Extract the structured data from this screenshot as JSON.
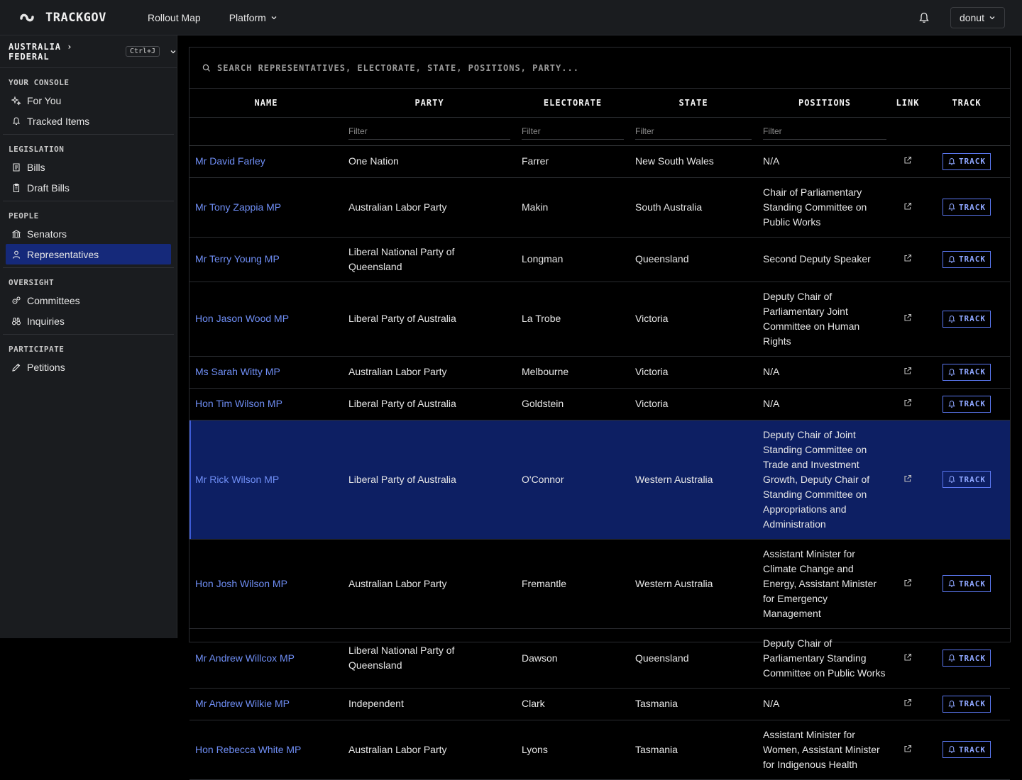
{
  "app": {
    "logo_text": "TRACKGOV",
    "nav": [
      {
        "label": "Rollout Map"
      },
      {
        "label": "Platform"
      }
    ],
    "user": "donut"
  },
  "sidebar": {
    "jurisdiction": "AUSTRALIA › FEDERAL",
    "shortcut": "Ctrl+J",
    "sections": [
      {
        "title": "YOUR CONSOLE",
        "items": [
          {
            "label": "For You",
            "icon": "sparkle-icon"
          },
          {
            "label": "Tracked Items",
            "icon": "bell-icon"
          }
        ]
      },
      {
        "title": "LEGISLATION",
        "items": [
          {
            "label": "Bills",
            "icon": "scroll-icon"
          },
          {
            "label": "Draft Bills",
            "icon": "clipboard-icon"
          }
        ]
      },
      {
        "title": "PEOPLE",
        "items": [
          {
            "label": "Senators",
            "icon": "building-icon"
          },
          {
            "label": "Representatives",
            "icon": "person-icon"
          }
        ]
      },
      {
        "title": "OVERSIGHT",
        "items": [
          {
            "label": "Committees",
            "icon": "cog-group-icon"
          },
          {
            "label": "Inquiries",
            "icon": "binoculars-icon"
          }
        ]
      },
      {
        "title": "PARTICIPATE",
        "items": [
          {
            "label": "Petitions",
            "icon": "pen-icon"
          }
        ]
      }
    ],
    "active_item": "Representatives"
  },
  "search": {
    "placeholder": "SEARCH REPRESENTATIVES, ELECTORATE, STATE, POSITIONS, PARTY..."
  },
  "table": {
    "columns": [
      "NAME",
      "PARTY",
      "ELECTORATE",
      "STATE",
      "POSITIONS",
      "LINK",
      "TRACK"
    ],
    "filter_placeholder": "Filter",
    "track_label": "TRACK",
    "rows": [
      {
        "name": "Mr David Farley",
        "party": "One Nation",
        "electorate": "Farrer",
        "state": "New South Wales",
        "positions": "N/A"
      },
      {
        "name": "Mr Tony Zappia MP",
        "party": "Australian Labor Party",
        "electorate": "Makin",
        "state": "South Australia",
        "positions": "Chair of Parliamentary Standing Committee on Public Works"
      },
      {
        "name": "Mr Terry Young MP",
        "party": "Liberal National Party of Queensland",
        "electorate": "Longman",
        "state": "Queensland",
        "positions": "Second Deputy Speaker"
      },
      {
        "name": "Hon Jason Wood MP",
        "party": "Liberal Party of Australia",
        "electorate": "La Trobe",
        "state": "Victoria",
        "positions": "Deputy Chair of Parliamentary Joint Committee on Human Rights"
      },
      {
        "name": "Ms Sarah Witty MP",
        "party": "Australian Labor Party",
        "electorate": "Melbourne",
        "state": "Victoria",
        "positions": "N/A"
      },
      {
        "name": "Hon Tim Wilson MP",
        "party": "Liberal Party of Australia",
        "electorate": "Goldstein",
        "state": "Victoria",
        "positions": "N/A"
      },
      {
        "name": "Mr Rick Wilson MP",
        "party": "Liberal Party of Australia",
        "electorate": "O'Connor",
        "state": "Western Australia",
        "positions": "Deputy Chair of Joint Standing Committee on Trade and Investment Growth, Deputy Chair of Standing Committee on Appropriations and Administration",
        "selected": true
      },
      {
        "name": "Hon Josh Wilson MP",
        "party": "Australian Labor Party",
        "electorate": "Fremantle",
        "state": "Western Australia",
        "positions": "Assistant Minister for Climate Change and Energy, Assistant Minister for Emergency Management"
      },
      {
        "name": "Mr Andrew Willcox MP",
        "party": "Liberal National Party of Queensland",
        "electorate": "Dawson",
        "state": "Queensland",
        "positions": "Deputy Chair of Parliamentary Standing Committee on Public Works"
      },
      {
        "name": "Mr Andrew Wilkie MP",
        "party": "Independent",
        "electorate": "Clark",
        "state": "Tasmania",
        "positions": "N/A"
      },
      {
        "name": "Hon Rebecca White MP",
        "party": "Australian Labor Party",
        "electorate": "Lyons",
        "state": "Tasmania",
        "positions": "Assistant Minister for Women, Assistant Minister for Indigenous Health"
      }
    ]
  }
}
